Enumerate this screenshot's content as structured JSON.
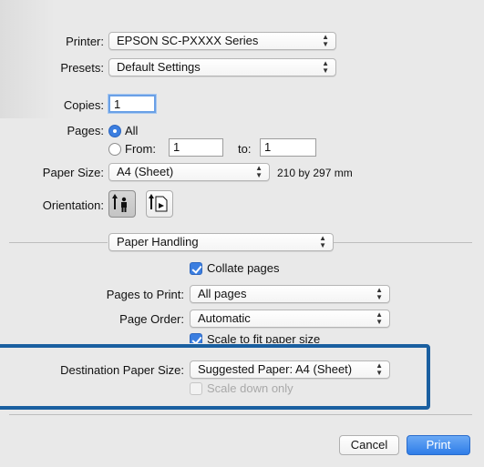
{
  "printer": {
    "label": "Printer:",
    "value": "EPSON SC-PXXXX Series"
  },
  "presets": {
    "label": "Presets:",
    "value": "Default Settings"
  },
  "copies": {
    "label": "Copies:",
    "value": "1"
  },
  "pages": {
    "label": "Pages:",
    "all_label": "All",
    "from_label": "From:",
    "from_value": "1",
    "to_label": "to:",
    "to_value": "1"
  },
  "paper_size": {
    "label": "Paper Size:",
    "value": "A4 (Sheet)",
    "dimensions": "210 by 297 mm"
  },
  "orientation": {
    "label": "Orientation:",
    "portrait_icon": "portrait-orientation-icon",
    "landscape_icon": "landscape-orientation-icon"
  },
  "section_popup": {
    "value": "Paper Handling"
  },
  "paper_handling": {
    "collate_label": "Collate pages",
    "pages_to_print_label": "Pages to Print:",
    "pages_to_print_value": "All pages",
    "page_order_label": "Page Order:",
    "page_order_value": "Automatic",
    "scale_label": "Scale to fit paper size",
    "dest_paper_label": "Destination Paper Size:",
    "dest_paper_value": "Suggested Paper: A4 (Sheet)",
    "scale_down_label": "Scale down only"
  },
  "buttons": {
    "cancel": "Cancel",
    "print": "Print"
  },
  "colors": {
    "highlight_border": "#1a5fa0",
    "accent": "#3b7ee0"
  }
}
